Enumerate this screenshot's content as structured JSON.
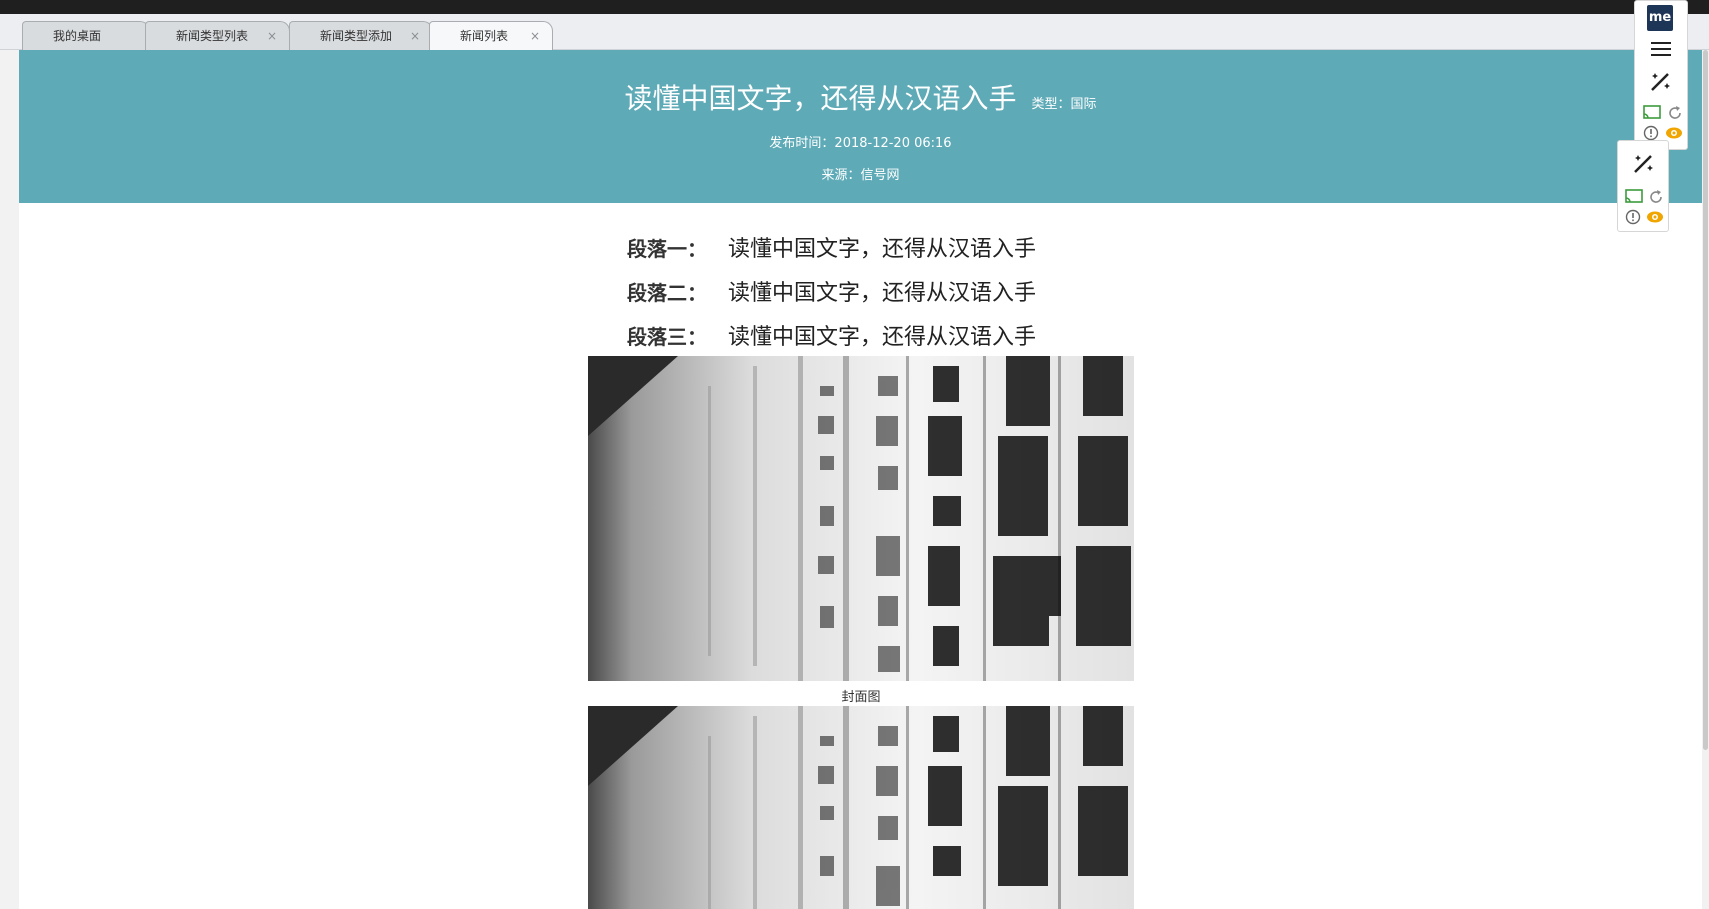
{
  "tabs": [
    {
      "label": "我的桌面",
      "closable": false
    },
    {
      "label": "新闻类型列表",
      "closable": true
    },
    {
      "label": "新闻类型添加",
      "closable": true
    },
    {
      "label": "新闻列表",
      "closable": true,
      "active": true
    }
  ],
  "close_glyph": "×",
  "article": {
    "title": "读懂中国文字，还得从汉语入手",
    "type": "类型：国际",
    "publish_time": "发布时间：2018-12-20 06:16",
    "source": "来源：信号网",
    "paragraphs": [
      {
        "label": "段落一：",
        "text": "读懂中国文字，还得从汉语入手"
      },
      {
        "label": "段落二：",
        "text": "读懂中国文字，还得从汉语入手"
      },
      {
        "label": "段落三：",
        "text": "读懂中国文字，还得从汉语入手"
      }
    ],
    "cover_caption": "封面图"
  },
  "colors": {
    "header_bg": "#5eaab7",
    "topbar": "#1f1f1f"
  },
  "extension": {
    "logo_text": "me"
  },
  "icons": [
    "menu-icon",
    "magic-wand-icon",
    "cast-icon",
    "refresh-icon",
    "alert-icon",
    "eye-icon",
    "collapse-arrow-icon",
    "close-icon"
  ]
}
